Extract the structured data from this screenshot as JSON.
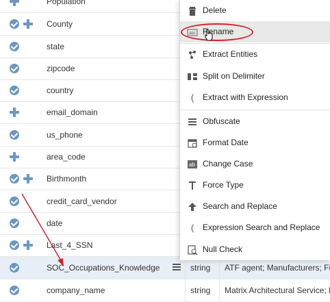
{
  "columns": [
    {
      "icons": [
        "plus"
      ],
      "name": "Population",
      "type": "",
      "sample": ""
    },
    {
      "icons": [
        "check",
        "plus"
      ],
      "name": "County",
      "type": "",
      "sample": ""
    },
    {
      "icons": [
        "check"
      ],
      "name": "state",
      "type": "",
      "sample": ""
    },
    {
      "icons": [
        "check"
      ],
      "name": "zipcode",
      "type": "",
      "sample": ""
    },
    {
      "icons": [
        "check"
      ],
      "name": "country",
      "type": "",
      "sample": ""
    },
    {
      "icons": [
        "plus"
      ],
      "name": "email_domain",
      "type": "",
      "sample": ""
    },
    {
      "icons": [
        "check"
      ],
      "name": "us_phone",
      "type": "",
      "sample": ""
    },
    {
      "icons": [
        "plus"
      ],
      "name": "area_code",
      "type": "",
      "sample": ""
    },
    {
      "icons": [
        "check",
        "plus"
      ],
      "name": "Birthmonth",
      "type": "",
      "sample": ""
    },
    {
      "icons": [
        "check"
      ],
      "name": "credit_card_vendor",
      "type": "",
      "sample": ""
    },
    {
      "icons": [
        "check"
      ],
      "name": "date",
      "type": "",
      "sample": ""
    },
    {
      "icons": [
        "check",
        "plus"
      ],
      "name": "Last_4_SSN",
      "type": "",
      "sample": ""
    },
    {
      "icons": [
        "check"
      ],
      "name": "SOC_Occupations_Knowledge",
      "type": "string",
      "sample": "ATF agent; Manufacturers; Fi",
      "selected": true
    },
    {
      "icons": [
        "check"
      ],
      "name": "company_name",
      "type": "string",
      "sample": "Matrix Architectural Service; H"
    }
  ],
  "menu": [
    {
      "label": "Delete",
      "icon": "trash-icon"
    },
    {
      "label": "Rename",
      "icon": "rename-icon",
      "hover": true
    },
    {
      "label": "Extract Entities",
      "icon": "extract-entities-icon"
    },
    {
      "label": "Split on Delimiter",
      "icon": "split-icon"
    },
    {
      "label": "Extract with Expression",
      "icon": "expression-icon"
    },
    {
      "label": "Obfuscate",
      "icon": "obfuscate-icon"
    },
    {
      "label": "Format Date",
      "icon": "calendar-icon"
    },
    {
      "label": "Change Case",
      "icon": "change-case-icon"
    },
    {
      "label": "Force Type",
      "icon": "force-type-icon"
    },
    {
      "label": "Search and Replace",
      "icon": "search-replace-icon"
    },
    {
      "label": "Expression Search and Replace",
      "icon": "expression-search-replace-icon"
    },
    {
      "label": "Null Check",
      "icon": "null-check-icon"
    }
  ],
  "colors": {
    "accent": "#6a98c4",
    "highlight": "#d0242a",
    "selected_row": "#e8eef6"
  }
}
